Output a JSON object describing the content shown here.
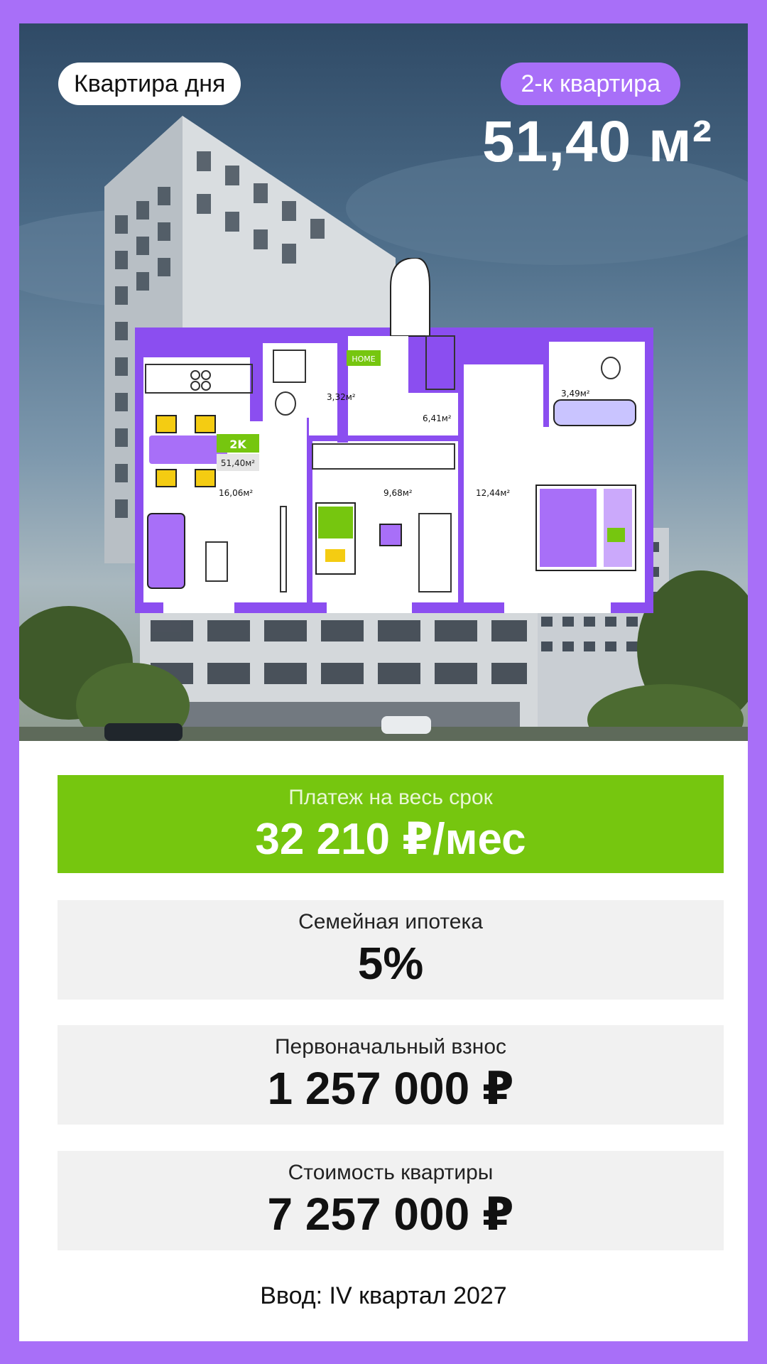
{
  "hero": {
    "badge_day": "Квартира дня",
    "badge_type": "2-к квартира",
    "area": "51,40 м²"
  },
  "plan": {
    "total_badge": "2K",
    "total_area": "51,40м²",
    "rooms": {
      "bath1": "3,32м²",
      "bath2": "3,49м²",
      "hall": "6,41м²",
      "living": "16,06м²",
      "bedroom1": "9,68м²",
      "bedroom2": "12,44м²"
    },
    "door_sign": "HOME",
    "colors": {
      "accent": "#a86ff8",
      "wall": "#8b4ef0",
      "furniture_yellow": "#f4cc12",
      "green": "#76c60f"
    }
  },
  "info": {
    "payment_label": "Платеж на весь срок",
    "payment_value": "32 210 ₽/мес",
    "rate_label": "Семейная ипотека",
    "rate_value": "5%",
    "down_label": "Первоначальный взнос",
    "down_value": "1 257 000 ₽",
    "price_label": "Стоимость квартиры",
    "price_value": "7 257 000 ₽",
    "delivery": "Ввод: IV квартал 2027"
  },
  "colors": {
    "background": "#a86ff8",
    "payment_green": "#76c60f",
    "box_grey": "#f1f1f1"
  }
}
